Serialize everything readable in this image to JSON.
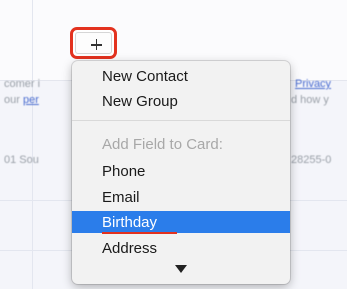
{
  "background": {
    "left_line1": "comer i",
    "left_line2_prefix": "our ",
    "left_line2_link": "per",
    "left_line3": "01 Sou",
    "right_line1_link": "Privacy",
    "right_line2": "d how y",
    "right_line3": "28255-0"
  },
  "add_button": {
    "label": "+"
  },
  "menu": {
    "items": [
      {
        "label": "New Contact"
      },
      {
        "label": "New Group"
      },
      {
        "label": "Add Field to Card:"
      },
      {
        "label": "Phone"
      },
      {
        "label": "Email"
      },
      {
        "label": "Birthday"
      },
      {
        "label": "Address"
      }
    ]
  }
}
